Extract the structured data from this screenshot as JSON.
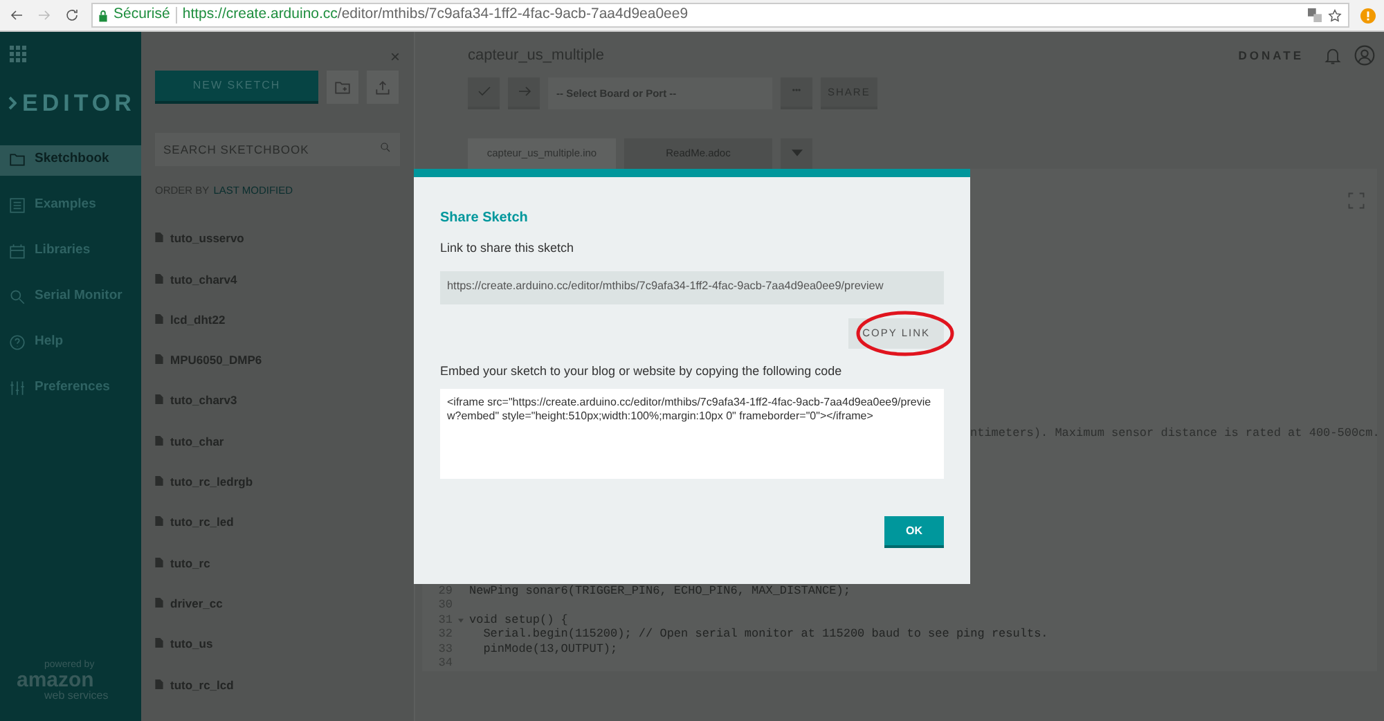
{
  "browser": {
    "secure_label": "Sécurisé",
    "url_host": "https://create.arduino.cc",
    "url_path": "/editor/mthibs/7c9afa34-1ff2-4fac-9acb-7aa4d9ea0ee9"
  },
  "sidebar": {
    "logo": "EDITOR",
    "items": [
      {
        "label": "Sketchbook",
        "kind": "folder",
        "selected": true
      },
      {
        "label": "Examples",
        "kind": "list",
        "selected": false
      },
      {
        "label": "Libraries",
        "kind": "library",
        "selected": false
      },
      {
        "label": "Serial Monitor",
        "kind": "monitor",
        "selected": false
      },
      {
        "label": "Help",
        "kind": "help",
        "selected": false
      },
      {
        "label": "Preferences",
        "kind": "sliders",
        "selected": false
      }
    ],
    "footer": {
      "top": "powered by",
      "middle": "amazon",
      "bottom": "web services"
    }
  },
  "sketchbook": {
    "close": "×",
    "new_sketch": "NEW SKETCH",
    "search_placeholder": "SEARCH SKETCHBOOK",
    "order_by_label": "ORDER BY",
    "order_by_value": "LAST MODIFIED",
    "sketches": [
      "tuto_usservo",
      "tuto_charv4",
      "lcd_dht22",
      "MPU6050_DMP6",
      "tuto_charv3",
      "tuto_char",
      "tuto_rc_ledrgb",
      "tuto_rc_led",
      "tuto_rc",
      "driver_cc",
      "tuto_us",
      "tuto_rc_lcd"
    ]
  },
  "main": {
    "title": "capteur_us_multiple",
    "donate": "DONATE",
    "board_placeholder": "-- Select Board or Port --",
    "more": "•••",
    "share": "SHARE",
    "tabs": [
      {
        "label": "capteur_us_multiple.ino",
        "selected": true
      },
      {
        "label": "ReadMe.adoc",
        "selected": false
      }
    ],
    "partial_line": "ntimeters). Maximum sensor distance is rated at 400-500cm.",
    "lines": [
      {
        "number": "29",
        "text": "NewPing sonar6(TRIGGER_PIN6, ECHO_PIN6, MAX_DISTANCE);",
        "fold": false
      },
      {
        "number": "30",
        "fold": false
      },
      {
        "number": "31",
        "text": "void setup() {",
        "fold": true
      },
      {
        "number": "32",
        "text": "  Serial.begin(115200); // Open serial monitor at 115200 baud to see ping results.",
        "fold": false
      },
      {
        "number": "33",
        "text": "  pinMode(13,OUTPUT);",
        "fold": false
      },
      {
        "number": "34",
        "fold": false
      }
    ]
  },
  "modal": {
    "title": "Share Sketch",
    "link_label": "Link to share this sketch",
    "link_value": "https://create.arduino.cc/editor/mthibs/7c9afa34-1ff2-4fac-9acb-7aa4d9ea0ee9/preview",
    "copy_button": "COPY LINK",
    "copy_highlighted": true,
    "embed_label": "Embed your sketch to your blog or website by copying the following code",
    "embed_code": "<iframe src=\"https://create.arduino.cc/editor/mthibs/7c9afa34-1ff2-4fac-9acb-7aa4d9ea0ee9/preview?embed\" style=\"height:510px;width:100%;margin:10px 0\" frameborder=\"0\"></iframe>",
    "ok": "OK"
  }
}
